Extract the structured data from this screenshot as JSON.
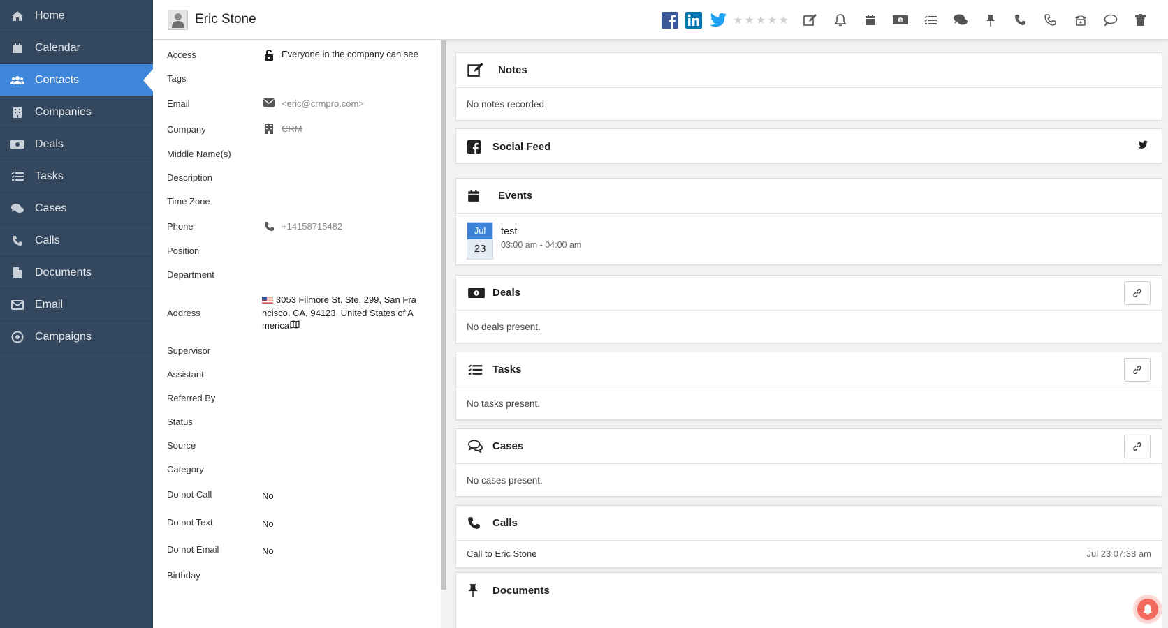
{
  "sidebar": {
    "items": [
      {
        "label": "Home",
        "icon": "home-icon"
      },
      {
        "label": "Calendar",
        "icon": "calendar-icon"
      },
      {
        "label": "Contacts",
        "icon": "users-icon",
        "active": true
      },
      {
        "label": "Companies",
        "icon": "building-icon"
      },
      {
        "label": "Deals",
        "icon": "money-icon"
      },
      {
        "label": "Tasks",
        "icon": "checklist-icon"
      },
      {
        "label": "Cases",
        "icon": "comments-icon"
      },
      {
        "label": "Calls",
        "icon": "phone-icon"
      },
      {
        "label": "Documents",
        "icon": "file-icon"
      },
      {
        "label": "Email",
        "icon": "envelope-icon"
      },
      {
        "label": "Campaigns",
        "icon": "target-icon"
      }
    ]
  },
  "header": {
    "contact_name": "Eric Stone",
    "rating": 0,
    "rating_max": 5
  },
  "details": {
    "access_label": "Access",
    "access_value": "Everyone in the company can see",
    "tags_label": "Tags",
    "email_label": "Email",
    "email_value": "<eric@crmpro.com>",
    "company_label": "Company",
    "company_value": "CRM",
    "middle_label": "Middle Name(s)",
    "description_label": "Description",
    "timezone_label": "Time Zone",
    "phone_label": "Phone",
    "phone_value": "+14158715482",
    "position_label": "Position",
    "department_label": "Department",
    "address_label": "Address",
    "address_value": "3053 Filmore St. Ste. 299, San Francisco, CA, 94123, United States of America",
    "supervisor_label": "Supervisor",
    "assistant_label": "Assistant",
    "referred_label": "Referred By",
    "status_label": "Status",
    "source_label": "Source",
    "category_label": "Category",
    "donotcall_label": "Do not Call",
    "donotcall_value": "No",
    "donottext_label": "Do not Text",
    "donottext_value": "No",
    "donotemail_label": "Do not Email",
    "donotemail_value": "No",
    "birthday_label": "Birthday"
  },
  "cards": {
    "notes_title": "Notes",
    "notes_empty": "No notes recorded",
    "social_title": "Social Feed",
    "events_title": "Events",
    "event_month": "Jul",
    "event_day": "23",
    "event_name": "test",
    "event_time": "03:00 am - 04:00 am",
    "deals_title": "Deals",
    "deals_empty": "No deals present.",
    "tasks_title": "Tasks",
    "tasks_empty": "No tasks present.",
    "cases_title": "Cases",
    "cases_empty": "No cases present.",
    "calls_title": "Calls",
    "call_name": "Call to Eric Stone",
    "call_time": "Jul 23 07:38 am",
    "documents_title": "Documents"
  },
  "colors": {
    "sidebar_bg": "#33485e",
    "active_nav": "#3e86d9",
    "facebook": "#3b5998",
    "linkedin": "#0077b5",
    "twitter": "#1da1f2",
    "notification": "#f26a5e"
  }
}
